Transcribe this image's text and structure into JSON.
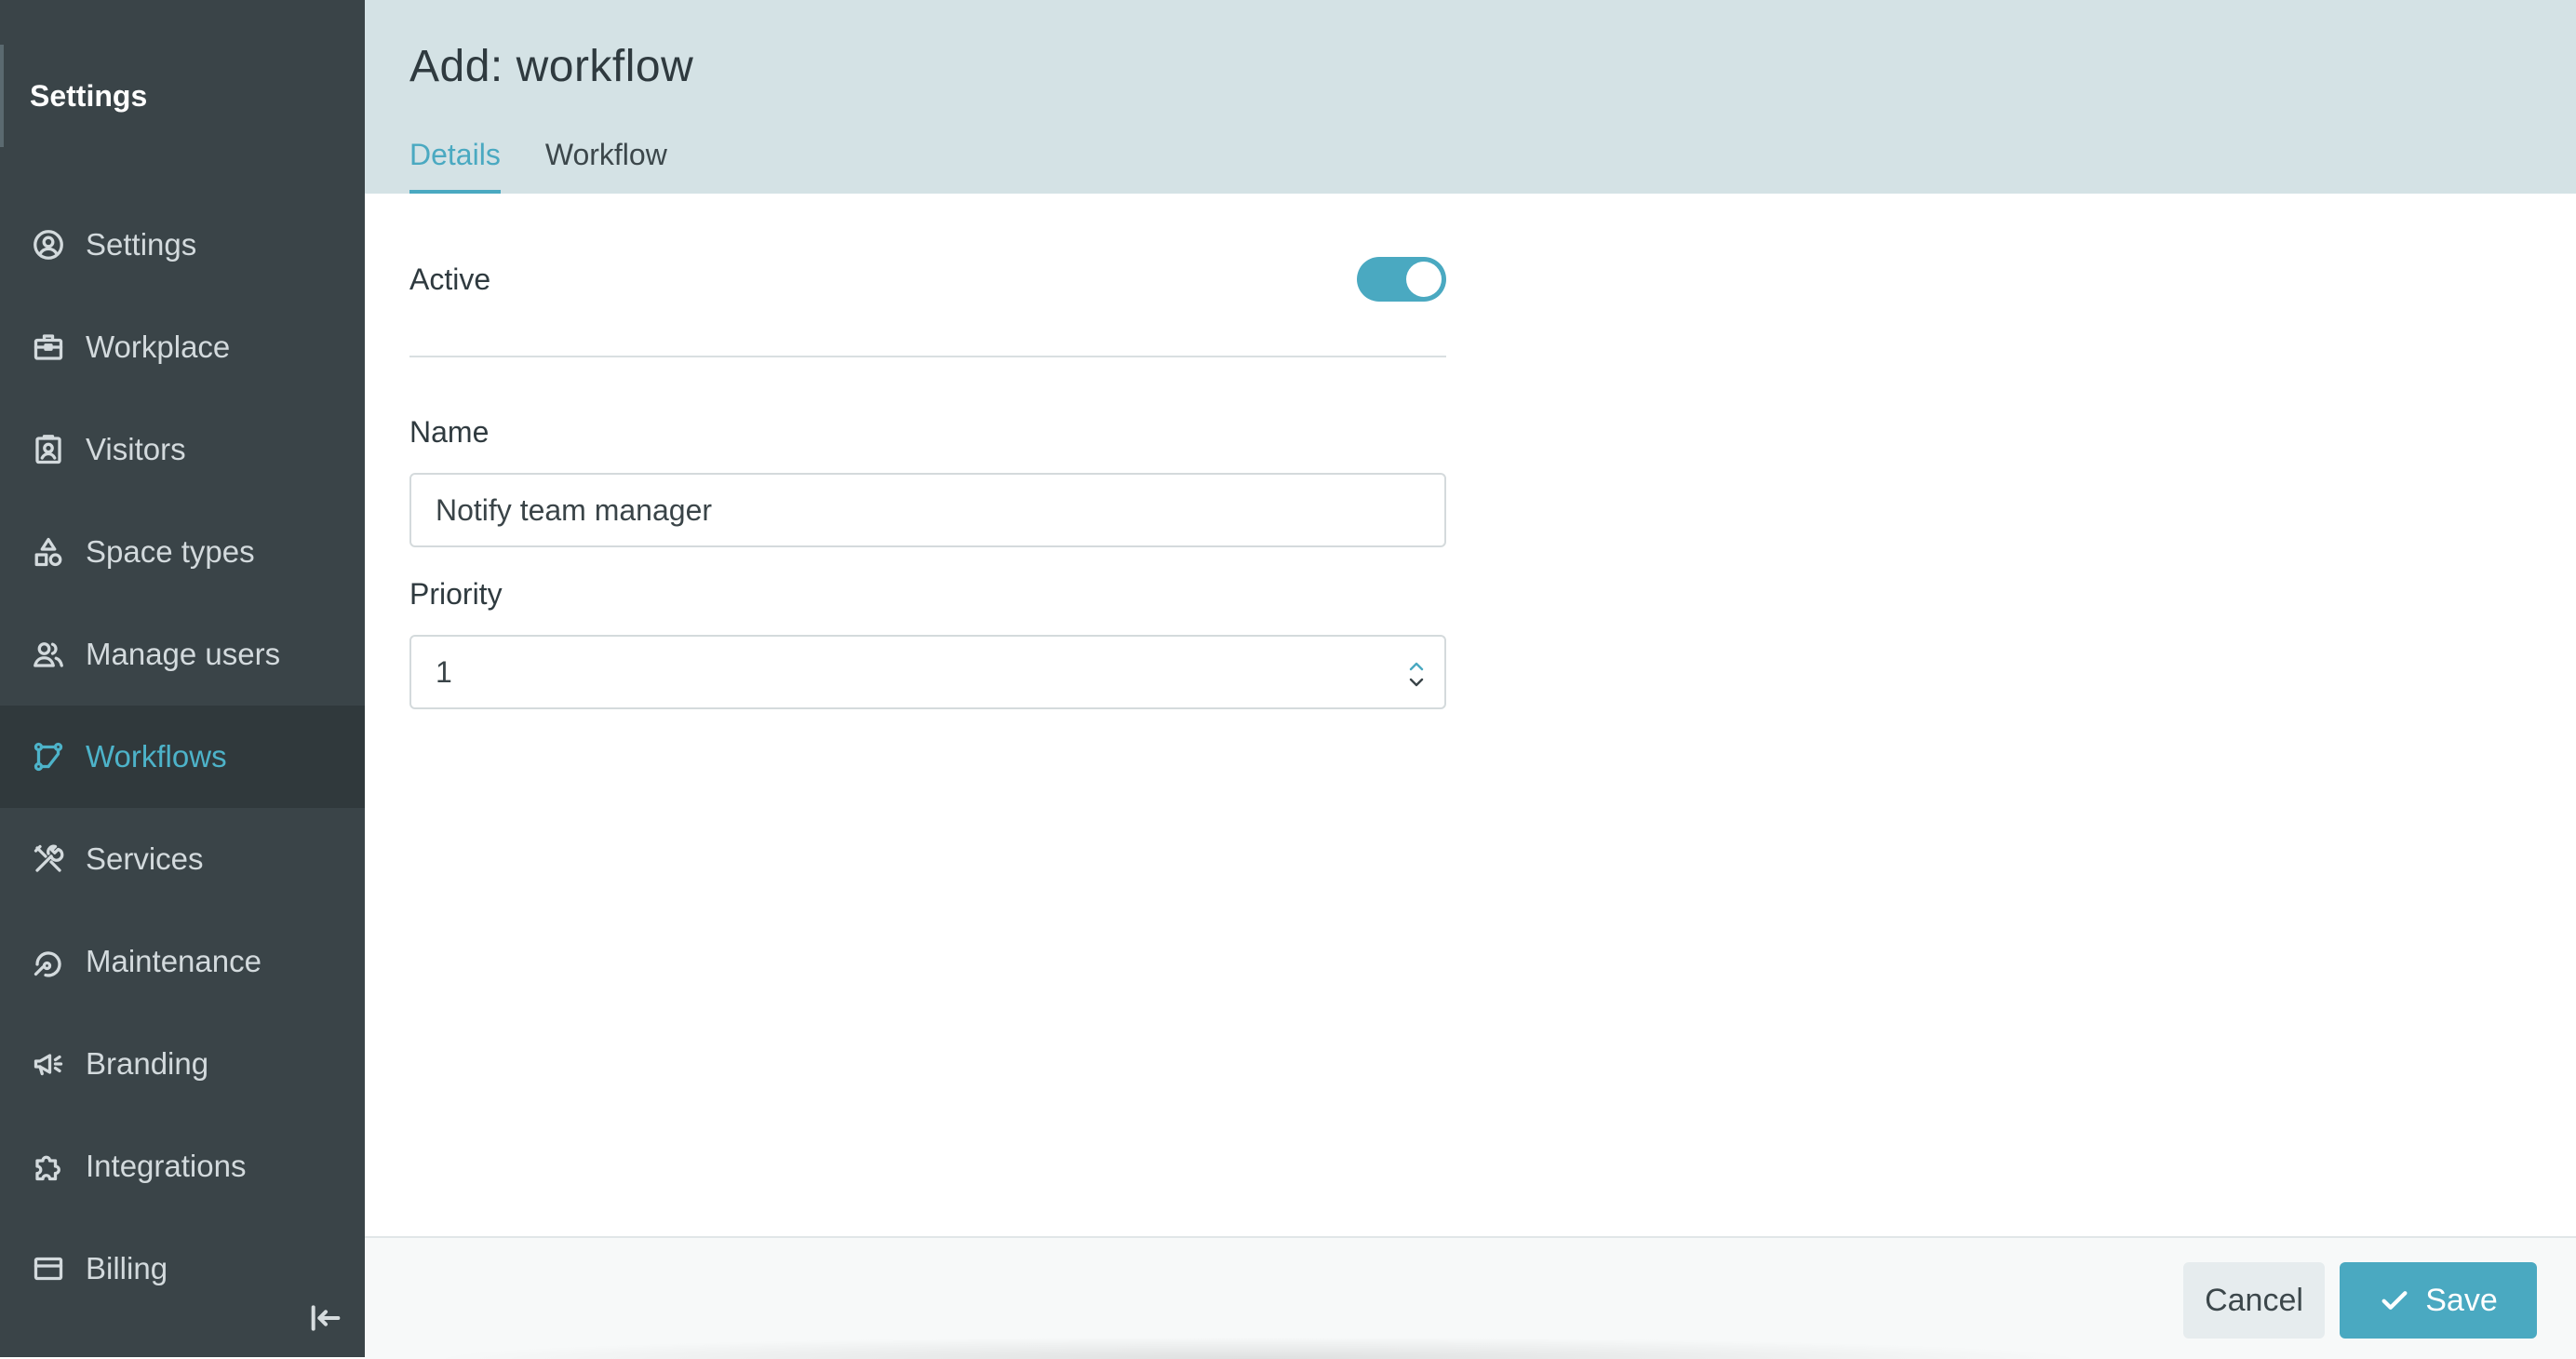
{
  "sidebar": {
    "title": "Settings",
    "items": [
      {
        "label": "Settings",
        "icon": "user-circle-icon"
      },
      {
        "label": "Workplace",
        "icon": "briefcase-icon"
      },
      {
        "label": "Visitors",
        "icon": "badge-icon"
      },
      {
        "label": "Space types",
        "icon": "shapes-icon"
      },
      {
        "label": "Manage users",
        "icon": "users-icon"
      },
      {
        "label": "Workflows",
        "icon": "workflow-icon",
        "active": true
      },
      {
        "label": "Services",
        "icon": "tools-icon"
      },
      {
        "label": "Maintenance",
        "icon": "maintenance-icon"
      },
      {
        "label": "Branding",
        "icon": "megaphone-icon"
      },
      {
        "label": "Integrations",
        "icon": "puzzle-icon"
      },
      {
        "label": "Billing",
        "icon": "credit-card-icon"
      }
    ],
    "collapse_icon": "collapse-left-icon"
  },
  "header": {
    "title": "Add: workflow",
    "tabs": [
      {
        "label": "Details",
        "active": true
      },
      {
        "label": "Workflow",
        "active": false
      }
    ]
  },
  "form": {
    "active_label": "Active",
    "active_on": true,
    "name_label": "Name",
    "name_value": "Notify team manager",
    "priority_label": "Priority",
    "priority_value": "1"
  },
  "footer": {
    "cancel_label": "Cancel",
    "save_label": "Save"
  },
  "colors": {
    "accent": "#4aa9c1",
    "sidebar_bg": "#3a4448",
    "header_bg": "#d4e2e5"
  }
}
